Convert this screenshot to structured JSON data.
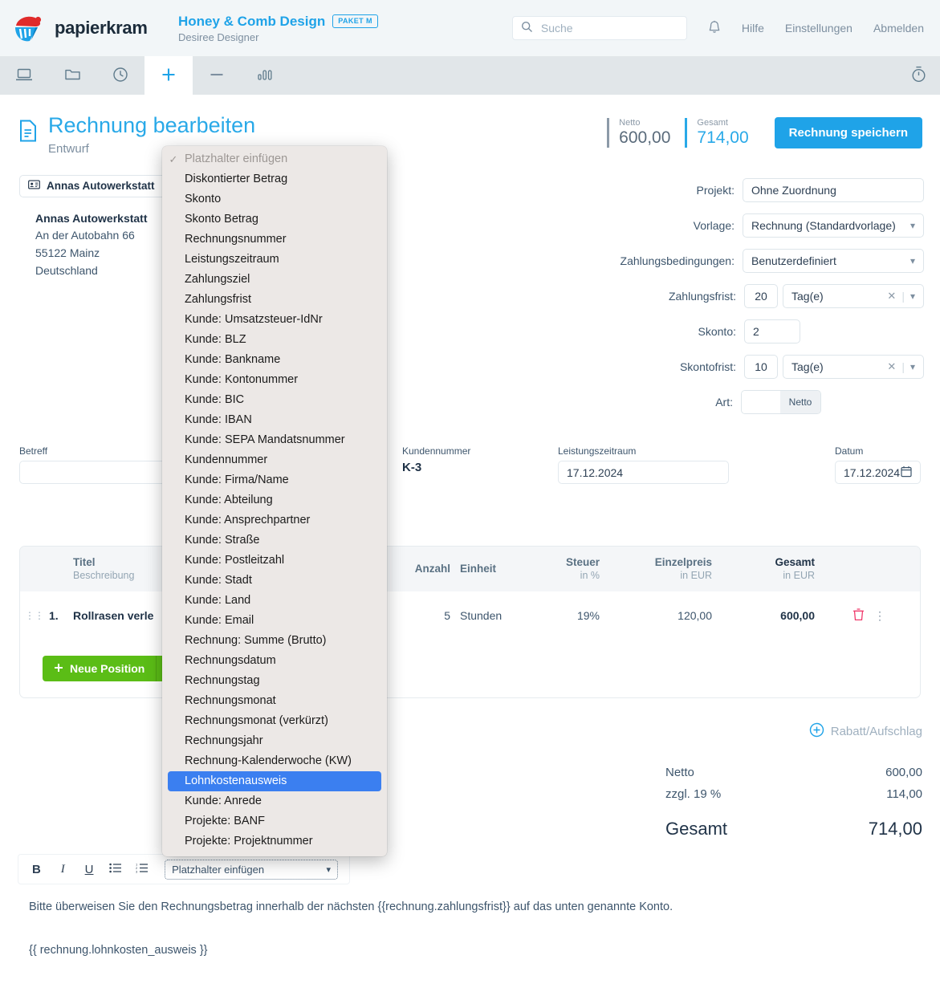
{
  "header": {
    "logo_text": "papierkram",
    "company": "Honey & Comb Design",
    "plan_badge": "PAKET M",
    "user": "Desiree Designer",
    "search_placeholder": "Suche",
    "links": [
      "Hilfe",
      "Einstellungen",
      "Abmelden"
    ]
  },
  "nav": {
    "items": [
      {
        "name": "dashboard",
        "icon": "laptop-icon"
      },
      {
        "name": "projects",
        "icon": "folder-icon"
      },
      {
        "name": "time-tracking",
        "icon": "clock-icon"
      },
      {
        "name": "income",
        "icon": "plus-icon"
      },
      {
        "name": "expenses",
        "icon": "minus-icon"
      },
      {
        "name": "reports",
        "icon": "bar-chart-icon"
      }
    ],
    "right_icon": "stopwatch-icon"
  },
  "page": {
    "title": "Rechnung bearbeiten",
    "subtitle": "Entwurf",
    "netto_label": "Netto",
    "netto_value": "600,00",
    "gesamt_label": "Gesamt",
    "gesamt_value": "714,00",
    "save_button": "Rechnung speichern"
  },
  "customer": {
    "chip": "Annas Autowerkstatt",
    "name": "Annas Autowerkstatt",
    "street": "An der Autobahn 66",
    "city": "55122 Mainz",
    "country": "Deutschland"
  },
  "form": {
    "projekt_label": "Projekt:",
    "projekt_value": "Ohne Zuordnung",
    "vorlage_label": "Vorlage:",
    "vorlage_value": "Rechnung (Standardvorlage)",
    "zahlungsbedingungen_label": "Zahlungsbedingungen:",
    "zahlungsbedingungen_value": "Benutzerdefiniert",
    "zahlungsfrist_label": "Zahlungsfrist:",
    "zahlungsfrist_value": "20",
    "zahlungsfrist_unit": "Tag(e)",
    "skonto_label": "Skonto:",
    "skonto_value": "2",
    "skontofrist_label": "Skontofrist:",
    "skontofrist_value": "10",
    "skontofrist_unit": "Tag(e)",
    "art_label": "Art:",
    "art_value": "Netto"
  },
  "mid": {
    "betreff_label": "Betreff",
    "betreff_value": "",
    "kundennummer_label": "Kundennummer",
    "kundennummer_value": "K-3",
    "leistungszeitraum_label": "Leistungszeitraum",
    "leistungszeitraum_value": "17.12.2024",
    "datum_label": "Datum",
    "datum_value": "17.12.2024"
  },
  "items": {
    "columns": {
      "titel": "Titel",
      "beschreibung": "Beschreibung",
      "anzahl": "Anzahl",
      "einheit": "Einheit",
      "steuer": "Steuer",
      "steuer_sub": "in %",
      "einzelpreis": "Einzelpreis",
      "einzelpreis_sub": "in EUR",
      "gesamt": "Gesamt",
      "gesamt_sub": "in EUR"
    },
    "rows": [
      {
        "pos": "1.",
        "titel": "Rollrasen verle",
        "anzahl": "5",
        "einheit": "Stunden",
        "steuer": "19%",
        "einzelpreis": "120,00",
        "gesamt": "600,00"
      }
    ],
    "new_position_button": "Neue Position"
  },
  "totals": {
    "rabatt_label": "Rabatt/Aufschlag",
    "netto_label": "Netto",
    "netto_value": "600,00",
    "tax_label": "zzgl. 19 %",
    "tax_value": "114,00",
    "gesamt_label": "Gesamt",
    "gesamt_value": "714,00"
  },
  "editor": {
    "toolbar": [
      "B",
      "I",
      "U"
    ],
    "placeholder_select_label": "Platzhalter einfügen",
    "body_line1": "Bitte überweisen Sie den Rechnungsbetrag innerhalb der nächsten {{rechnung.zahlungsfrist}} auf das unten genannte Konto.",
    "body_line2": "{{ rechnung.lohnkosten_ausweis }}"
  },
  "dropdown": {
    "placeholder": "Platzhalter einfügen",
    "selected": "Lohnkostenausweis",
    "highlight_color": "#3b7ff0",
    "items": [
      "Diskontierter Betrag",
      "Skonto",
      "Skonto Betrag",
      "Rechnungsnummer",
      "Leistungszeitraum",
      "Zahlungsziel",
      "Zahlungsfrist",
      "Kunde: Umsatzsteuer-IdNr",
      "Kunde: BLZ",
      "Kunde: Bankname",
      "Kunde: Kontonummer",
      "Kunde: BIC",
      "Kunde: IBAN",
      "Kunde: SEPA Mandatsnummer",
      "Kundennummer",
      "Kunde: Firma/Name",
      "Kunde: Abteilung",
      "Kunde: Ansprechpartner",
      "Kunde: Straße",
      "Kunde: Postleitzahl",
      "Kunde: Stadt",
      "Kunde: Land",
      "Kunde: Email",
      "Rechnung: Summe (Brutto)",
      "Rechnungsdatum",
      "Rechnungstag",
      "Rechnungsmonat",
      "Rechnungsmonat (verkürzt)",
      "Rechnungsjahr",
      "Rechnung-Kalenderwoche (KW)",
      "Lohnkostenausweis",
      "Kunde: Anrede",
      "Projekte: BANF",
      "Projekte: Projektnummer"
    ]
  },
  "colors": {
    "brand_blue": "#1fa3e8",
    "title_blue": "#29a9e8",
    "green": "#5bbd16",
    "delete_red": "#f0396b",
    "header_bg": "#f2f6f8",
    "nav_bg": "#e1e6e9"
  }
}
